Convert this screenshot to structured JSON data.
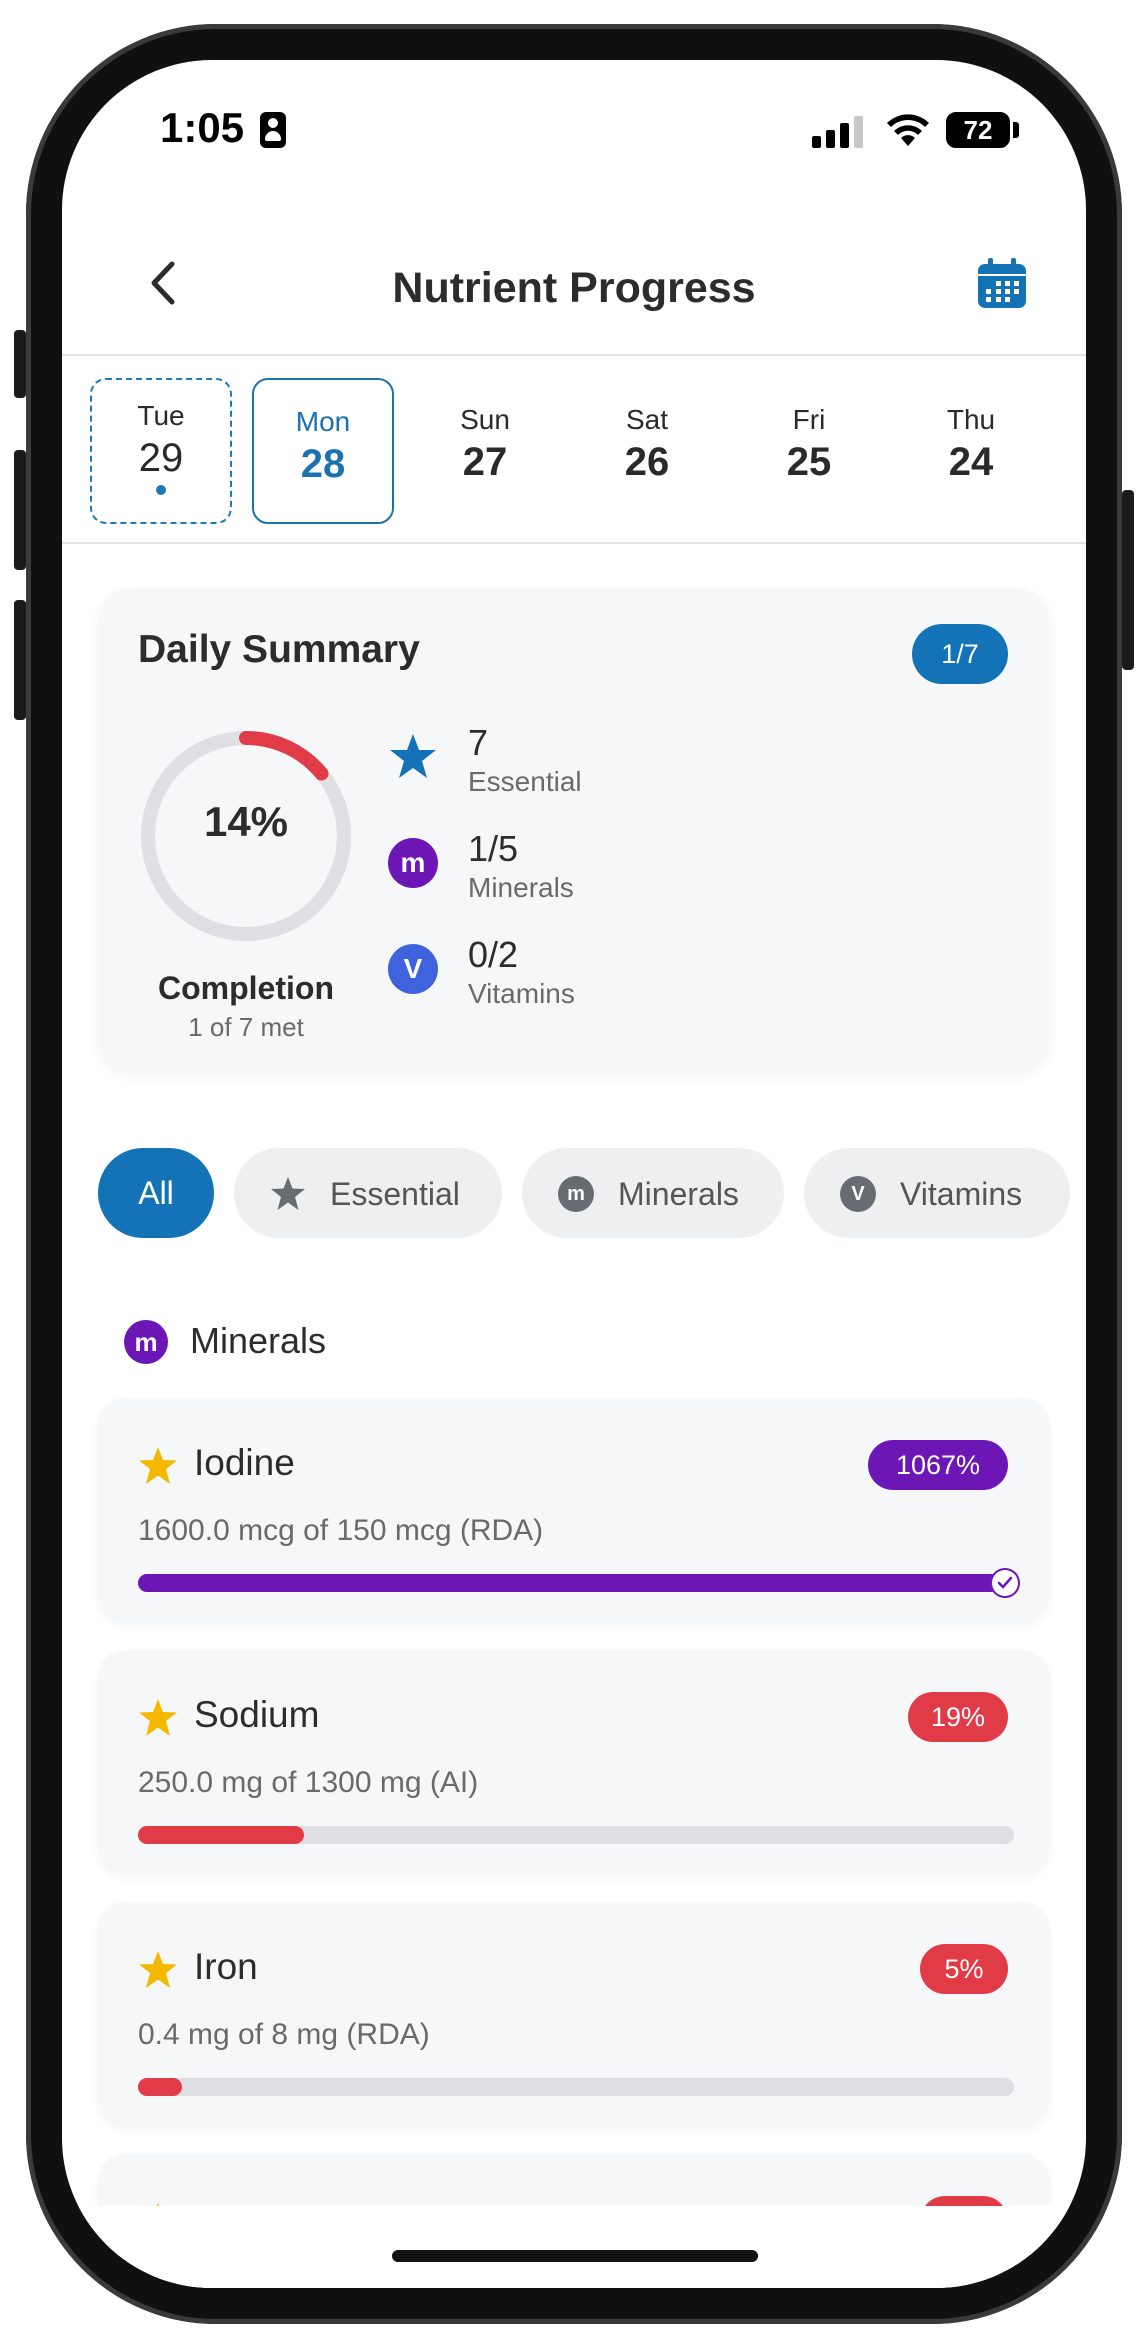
{
  "status_bar": {
    "time": "1:05",
    "battery": "72"
  },
  "header": {
    "title": "Nutrient Progress"
  },
  "days": [
    {
      "name": "Tue",
      "num": "29"
    },
    {
      "name": "Mon",
      "num": "28"
    },
    {
      "name": "Sun",
      "num": "27"
    },
    {
      "name": "Sat",
      "num": "26"
    },
    {
      "name": "Fri",
      "num": "25"
    },
    {
      "name": "Thu",
      "num": "24"
    }
  ],
  "summary": {
    "title": "Daily Summary",
    "badge": "1/7",
    "percent_label": "14%",
    "completion_fraction": 0.14,
    "completion_label": "Completion",
    "completion_sub": "1 of 7 met",
    "stats": [
      {
        "value": "7",
        "label": "Essential"
      },
      {
        "value": "1/5",
        "label": "Minerals",
        "icon_letter": "m"
      },
      {
        "value": "0/2",
        "label": "Vitamins",
        "icon_letter": "V"
      }
    ]
  },
  "filters": {
    "all": "All",
    "essential": "Essential",
    "minerals": "Minerals",
    "vitamins": "Vitamins",
    "minerals_icon_letter": "m",
    "vitamins_icon_letter": "V"
  },
  "section": {
    "title": "Minerals",
    "icon_letter": "m"
  },
  "nutrients": [
    {
      "name": "Iodine",
      "percent": "1067%",
      "detail": "1600.0 mcg of 150 mcg (RDA)",
      "progress": 1.0,
      "color": "#6b16b5"
    },
    {
      "name": "Sodium",
      "percent": "19%",
      "detail": "250.0 mg of 1300 mg (AI)",
      "progress": 0.19,
      "color": "#e23b48"
    },
    {
      "name": "Iron",
      "percent": "5%",
      "detail": "0.4 mg of 8 mg (RDA)",
      "progress": 0.05,
      "color": "#e23b48"
    }
  ],
  "colors": {
    "accent": "#1473b6",
    "minerals": "#6b16b5",
    "vitamins": "#3f63de",
    "warning": "#e23b48",
    "star": "#f5b800"
  }
}
